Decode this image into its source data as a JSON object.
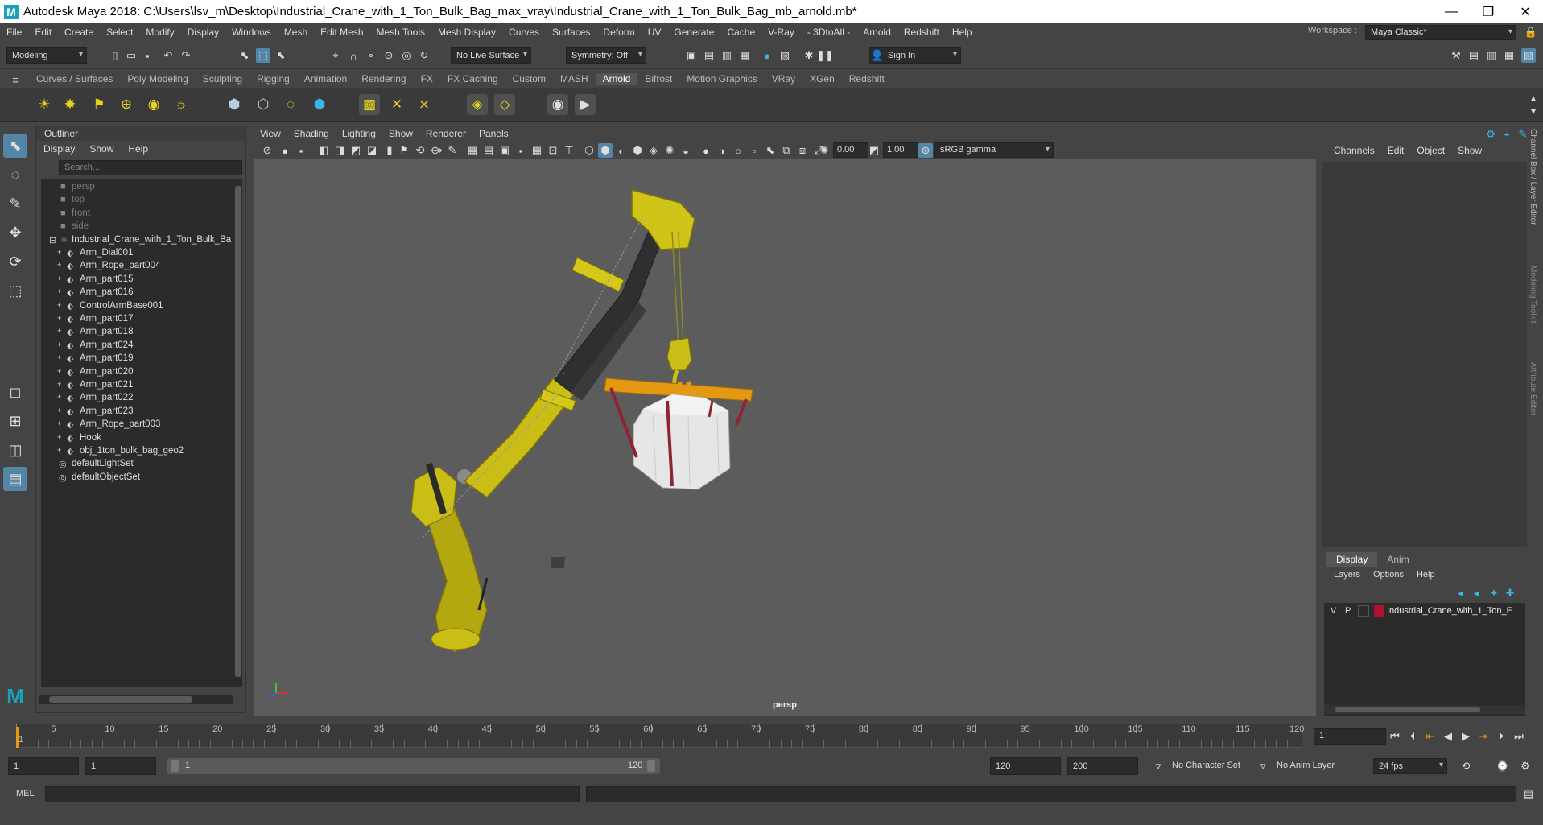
{
  "window": {
    "title": "Autodesk Maya 2018: C:\\Users\\lsv_m\\Desktop\\Industrial_Crane_with_1_Ton_Bulk_Bag_max_vray\\Industrial_Crane_with_1_Ton_Bulk_Bag_mb_arnold.mb*",
    "logo": "M",
    "minimize": "—",
    "restore": "❐",
    "close": "✕"
  },
  "menubar": {
    "items": [
      "File",
      "Edit",
      "Create",
      "Select",
      "Modify",
      "Display",
      "Windows",
      "Mesh",
      "Edit Mesh",
      "Mesh Tools",
      "Mesh Display",
      "Curves",
      "Surfaces",
      "Deform",
      "UV",
      "Generate",
      "Cache",
      "V-Ray",
      "- 3DtoAll -",
      "Arnold",
      "Redshift",
      "Help"
    ],
    "workspace_label": "Workspace :",
    "workspace_value": "Maya Classic*"
  },
  "statusline": {
    "mode": "Modeling",
    "live_surface": "No Live Surface",
    "symmetry": "Symmetry: Off",
    "sign_in": "Sign In"
  },
  "shelf_tabs": [
    "Curves / Surfaces",
    "Poly Modeling",
    "Sculpting",
    "Rigging",
    "Animation",
    "Rendering",
    "FX",
    "FX Caching",
    "Custom",
    "MASH",
    "Arnold",
    "Bifrost",
    "Motion Graphics",
    "VRay",
    "XGen",
    "Redshift"
  ],
  "active_shelf_tab": "Arnold",
  "outliner": {
    "title": "Outliner",
    "menu": [
      "Display",
      "Show",
      "Help"
    ],
    "search_placeholder": "Search...",
    "cameras": [
      "persp",
      "top",
      "front",
      "side"
    ],
    "group": "Industrial_Crane_with_1_Ton_Bulk_Ba",
    "children": [
      "Arm_Dial001",
      "Arm_Rope_part004",
      "Arm_part015",
      "Arm_part016",
      "ControlArmBase001",
      "Arm_part017",
      "Arm_part018",
      "Arm_part024",
      "Arm_part019",
      "Arm_part020",
      "Arm_part021",
      "Arm_part022",
      "Arm_part023",
      "Arm_Rope_part003",
      "Hook",
      "obj_1ton_bulk_bag_geo2"
    ],
    "sets": [
      "defaultLightSet",
      "defaultObjectSet"
    ]
  },
  "viewport": {
    "menu": [
      "View",
      "Shading",
      "Lighting",
      "Show",
      "Renderer",
      "Panels"
    ],
    "exposure": "0.00",
    "gamma": "1.00",
    "color_space": "sRGB gamma",
    "camera_label": "persp"
  },
  "channel_box": {
    "menu": [
      "Channels",
      "Edit",
      "Object",
      "Show"
    ],
    "tabs": [
      "Display",
      "Anim"
    ],
    "layer_menu": [
      "Layers",
      "Options",
      "Help"
    ],
    "layer": {
      "v": "V",
      "p": "P",
      "name": "Industrial_Crane_with_1_Ton_E",
      "color": "#b0112e"
    },
    "side_tabs": [
      "Channel Box / Layer Editor",
      "Modeling Toolkit",
      "Attribute Editor"
    ]
  },
  "timeline": {
    "ticks": [
      "1",
      "5",
      "10",
      "15",
      "20",
      "25",
      "30",
      "35",
      "40",
      "45",
      "50",
      "55",
      "60",
      "65",
      "70",
      "75",
      "80",
      "85",
      "90",
      "95",
      "100",
      "105",
      "110",
      "115",
      "120"
    ],
    "current_frame": "1"
  },
  "range": {
    "start": "1",
    "playback_start": "1",
    "slider_start": "1",
    "slider_end": "120",
    "playback_end": "120",
    "end": "200",
    "character_set": "No Character Set",
    "anim_layer": "No Anim Layer",
    "fps": "24 fps"
  },
  "mel": {
    "label": "MEL"
  },
  "colors": {
    "accent": "#5285a6",
    "crane_yellow": "#c9bd16",
    "beam_orange": "#e39a12",
    "bag_strap": "#8e2433"
  }
}
